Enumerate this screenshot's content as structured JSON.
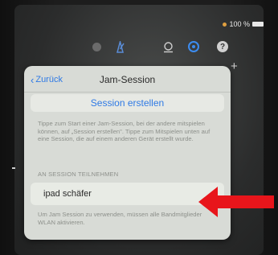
{
  "status": {
    "battery": "100 %"
  },
  "toolbar": {
    "icons": [
      "dim-circle-icon",
      "metronome-icon",
      "loop-icon",
      "session-settings-icon",
      "help-icon",
      "plus-icon"
    ],
    "accent_color": "#3c8cf0"
  },
  "popover": {
    "back_label": "Zurück",
    "title": "Jam-Session",
    "create_button": "Session erstellen",
    "info_text": "Tippe zum Start einer Jam-Session, bei der andere mitspielen können, auf „Session erstellen\". Tippe zum Mitspielen unten auf eine Session, die auf einem anderen Gerät erstellt wurde.",
    "section_label": "AN SESSION TEILNEHMEN",
    "sessions": [
      {
        "name": "ipad schäfer"
      }
    ],
    "footer_note": "Um Jam Session zu verwenden, müssen alle Bandmitglieder WLAN aktivieren."
  },
  "annotation": {
    "arrow_color": "#e8151b"
  }
}
